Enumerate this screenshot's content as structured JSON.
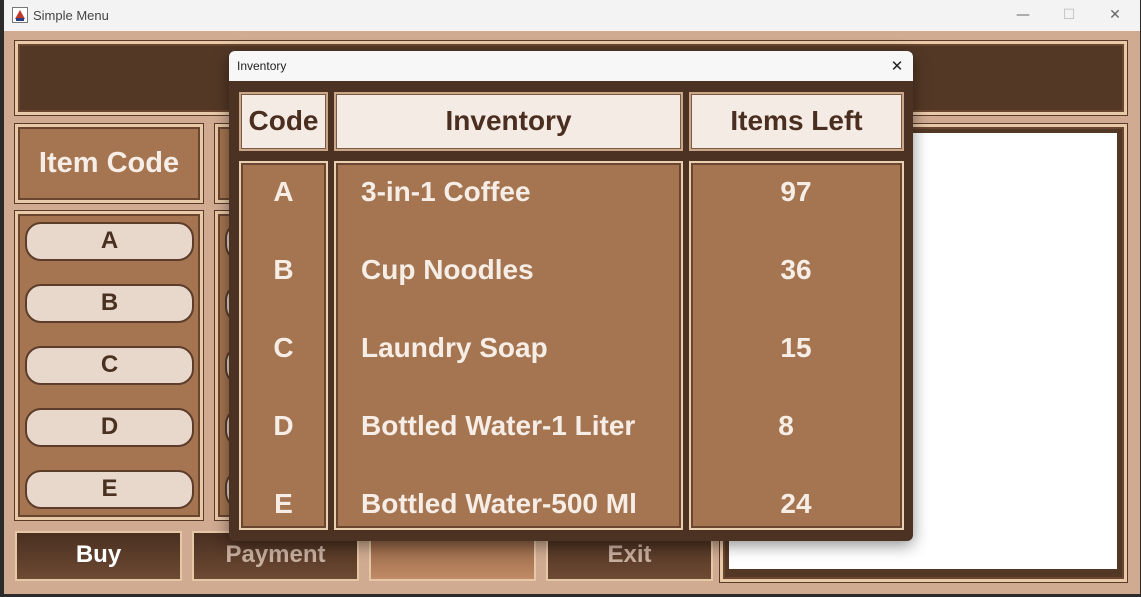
{
  "main_window": {
    "title": "Simple Menu",
    "controls": {
      "minimize": "—",
      "maximize": "☐",
      "close": "✕"
    }
  },
  "item_code_panel": {
    "header": "Item Code",
    "buttons": [
      "A",
      "B",
      "C",
      "D",
      "E"
    ]
  },
  "bottom_buttons": {
    "buy": "Buy",
    "payment": "Payment",
    "blank": "",
    "exit": "Exit"
  },
  "dialog": {
    "title": "Inventory",
    "close": "✕",
    "headers": {
      "code": "Code",
      "inventory": "Inventory",
      "items_left": "Items Left"
    },
    "rows": [
      {
        "code": "A",
        "name": "3-in-1 Coffee",
        "left": "97"
      },
      {
        "code": "B",
        "name": "Cup Noodles",
        "left": "36"
      },
      {
        "code": "C",
        "name": "Laundry Soap",
        "left": "15"
      },
      {
        "code": "D",
        "name": "Bottled Water-1 Liter",
        "left": "8"
      },
      {
        "code": "E",
        "name": "Bottled Water-500 Ml",
        "left": "24"
      }
    ]
  },
  "colors": {
    "frame": "#d0ab92",
    "dark_brown": "#543826",
    "mid_brown": "#a47550",
    "cream": "#f5ebe5"
  },
  "icons": {
    "app": "java-app-icon"
  }
}
